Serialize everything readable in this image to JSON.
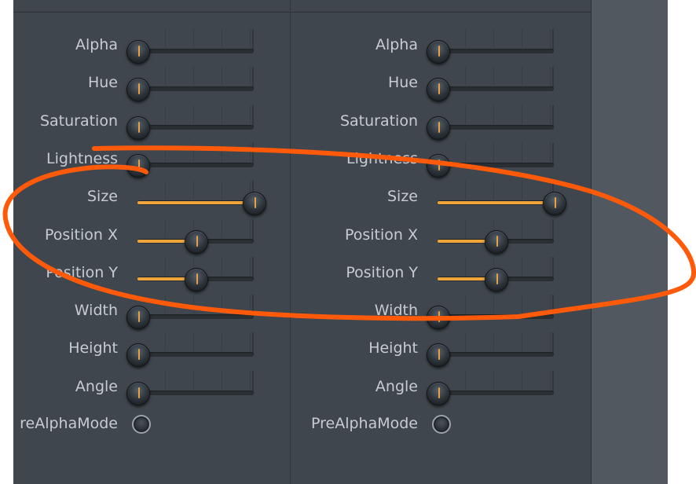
{
  "columns": [
    {
      "params": [
        {
          "label": "Alpha",
          "value": 0
        },
        {
          "label": "Hue",
          "value": 0
        },
        {
          "label": "Saturation",
          "value": 0
        },
        {
          "label": "Lightness",
          "value": 0
        },
        {
          "label": "Size",
          "value": 1.0
        },
        {
          "label": "Position X",
          "value": 0.5
        },
        {
          "label": "Position Y",
          "value": 0.5
        },
        {
          "label": "Width",
          "value": 0
        },
        {
          "label": "Height",
          "value": 0
        },
        {
          "label": "Angle",
          "value": 0
        }
      ],
      "toggle_label": "reAlphaMode"
    },
    {
      "params": [
        {
          "label": "Alpha",
          "value": 0
        },
        {
          "label": "Hue",
          "value": 0
        },
        {
          "label": "Saturation",
          "value": 0
        },
        {
          "label": "Lightness",
          "value": 0
        },
        {
          "label": "Size",
          "value": 1.0
        },
        {
          "label": "Position X",
          "value": 0.5
        },
        {
          "label": "Position Y",
          "value": 0.5
        },
        {
          "label": "Width",
          "value": 0
        },
        {
          "label": "Height",
          "value": 0
        },
        {
          "label": "Angle",
          "value": 0
        }
      ],
      "toggle_label": "PreAlphaMode"
    }
  ],
  "colors": {
    "panel_bg": "#3f464d",
    "slider_fill": "#f0a53a",
    "annotation_stroke": "#ff5a0a"
  }
}
